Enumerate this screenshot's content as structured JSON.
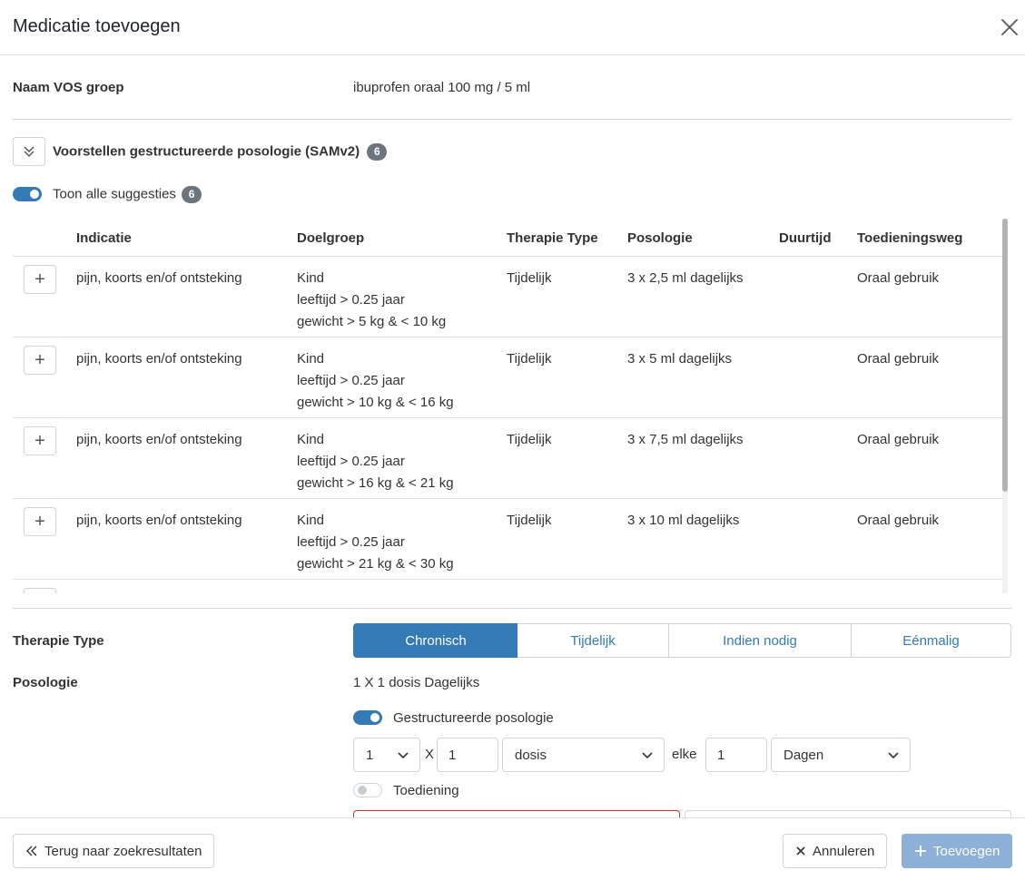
{
  "modal": {
    "title": "Medicatie toevoegen"
  },
  "vos": {
    "label": "Naam VOS groep",
    "value": "ibuprofen oraal 100 mg / 5 ml"
  },
  "proposals": {
    "title": "Voorstellen gestructureerde posologie (SAMv2)",
    "count": "6",
    "toggle_label": "Toon alle suggesties",
    "toggle_count": "6",
    "toggle_on": true,
    "columns": [
      "Indicatie",
      "Doelgroep",
      "Therapie Type",
      "Posologie",
      "Duurtijd",
      "Toedieningsweg"
    ],
    "rows": [
      {
        "indicatie": "pijn, koorts en/of ontsteking",
        "doelgroep": [
          "Kind",
          "leeftijd > 0.25 jaar",
          "gewicht > 5 kg & < 10 kg"
        ],
        "therapie": "Tijdelijk",
        "posologie": "3 x 2,5 ml dagelijks",
        "duurtijd": "",
        "toedieningsweg": "Oraal gebruik"
      },
      {
        "indicatie": "pijn, koorts en/of ontsteking",
        "doelgroep": [
          "Kind",
          "leeftijd > 0.25 jaar",
          "gewicht > 10 kg & < 16 kg"
        ],
        "therapie": "Tijdelijk",
        "posologie": "3 x 5 ml dagelijks",
        "duurtijd": "",
        "toedieningsweg": "Oraal gebruik"
      },
      {
        "indicatie": "pijn, koorts en/of ontsteking",
        "doelgroep": [
          "Kind",
          "leeftijd > 0.25 jaar",
          "gewicht > 16 kg & < 21 kg"
        ],
        "therapie": "Tijdelijk",
        "posologie": "3 x 7,5 ml dagelijks",
        "duurtijd": "",
        "toedieningsweg": "Oraal gebruik"
      },
      {
        "indicatie": "pijn, koorts en/of ontsteking",
        "doelgroep": [
          "Kind",
          "leeftijd > 0.25 jaar",
          "gewicht > 21 kg & < 30 kg"
        ],
        "therapie": "Tijdelijk",
        "posologie": "3 x 10 ml dagelijks",
        "duurtijd": "",
        "toedieningsweg": "Oraal gebruik"
      }
    ]
  },
  "therapy": {
    "label": "Therapie Type",
    "options": [
      "Chronisch",
      "Tijdelijk",
      "Indien nodig",
      "Eénmalig"
    ],
    "selected": "Chronisch"
  },
  "posologie": {
    "label": "Posologie",
    "summary": "1 X 1 dosis Dagelijks",
    "structured_toggle_label": "Gestructureerde posologie",
    "structured_on": true,
    "count_select": "1",
    "x_label": "X",
    "amount_value": "1",
    "unit_select": "dosis",
    "every_label": "elke",
    "interval_value": "1",
    "period_select": "Dagen",
    "admin_toggle_label": "Toediening",
    "admin_on": false
  },
  "footer": {
    "back_label": "Terug naar zoekresultaten",
    "cancel_label": "Annuleren",
    "add_label": "Toevoegen"
  },
  "colors": {
    "primary": "#337ab7",
    "primary_disabled": "#8cb0d7",
    "badge": "#6c757d",
    "error_border": "#c0392b"
  }
}
